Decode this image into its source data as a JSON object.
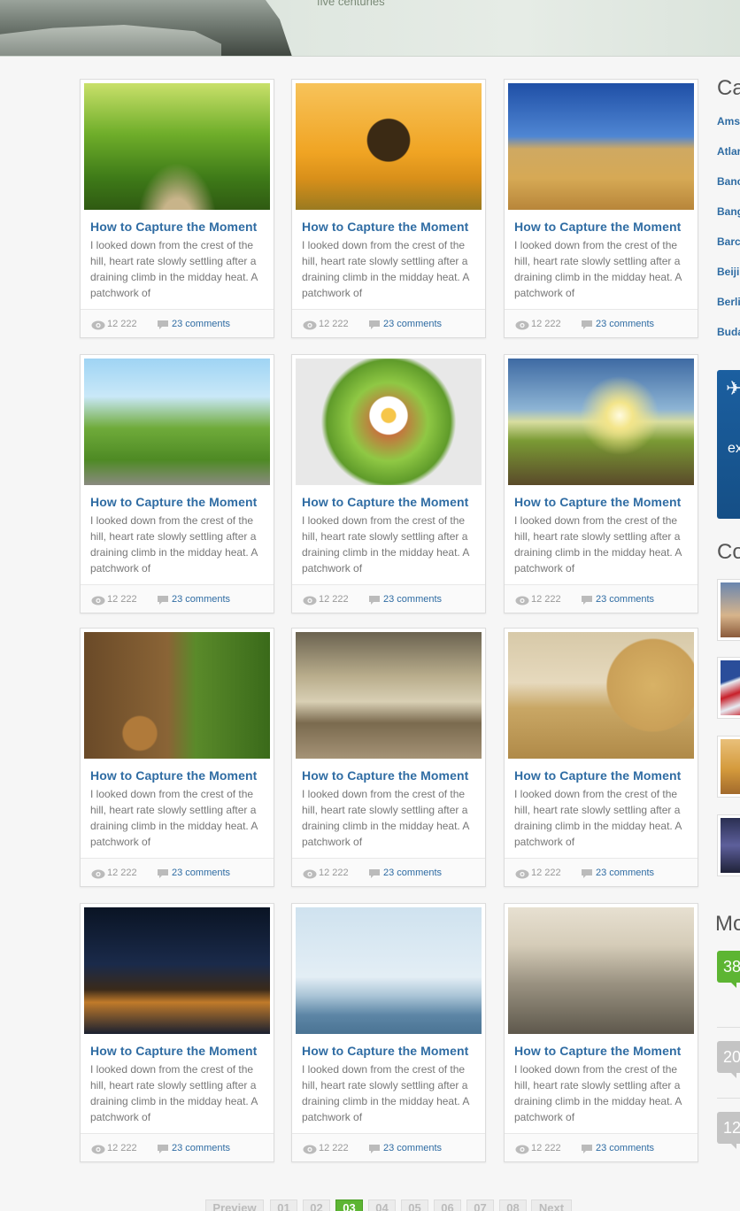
{
  "hero": {
    "tagline": "five centuries"
  },
  "posts": [
    {
      "title": "How to Capture the Moment",
      "excerpt": "I looked down from the crest of the hill, heart rate slowly settling after a draining climb in the midday heat. A patchwork of",
      "views": "12 222",
      "comments": "23 comments",
      "image": "forest-path"
    },
    {
      "title": "How to Capture the Moment",
      "excerpt": "I looked down from the crest of the hill, heart rate slowly settling after a draining climb in the midday heat. A patchwork of",
      "views": "12 222",
      "comments": "23 comments",
      "image": "orange-tree"
    },
    {
      "title": "How to Capture the Moment",
      "excerpt": "I looked down from the crest of the hill, heart rate slowly settling after a draining climb in the midday heat. A patchwork of",
      "views": "12 222",
      "comments": "23 comments",
      "image": "wheat-field"
    },
    {
      "title": "How to Capture the Moment",
      "excerpt": "I looked down from the crest of the hill, heart rate slowly settling after a draining climb in the midday heat. A patchwork of",
      "views": "12 222",
      "comments": "23 comments",
      "image": "fence-road"
    },
    {
      "title": "How to Capture the Moment",
      "excerpt": "I looked down from the crest of the hill, heart rate slowly settling after a draining climb in the midday heat. A patchwork of",
      "views": "12 222",
      "comments": "23 comments",
      "image": "salad"
    },
    {
      "title": "How to Capture the Moment",
      "excerpt": "I looked down from the crest of the hill, heart rate slowly settling after a draining climb in the midday heat. A patchwork of",
      "views": "12 222",
      "comments": "23 comments",
      "image": "sunrise-field"
    },
    {
      "title": "How to Capture the Moment",
      "excerpt": "I looked down from the crest of the hill, heart rate slowly settling after a draining climb in the midday heat. A patchwork of",
      "views": "12 222",
      "comments": "23 comments",
      "image": "wooden-cabin"
    },
    {
      "title": "How to Capture the Moment",
      "excerpt": "I looked down from the crest of the hill, heart rate slowly settling after a draining climb in the midday heat. A patchwork of",
      "views": "12 222",
      "comments": "23 comments",
      "image": "cloudy-sky"
    },
    {
      "title": "How to Capture the Moment",
      "excerpt": "I looked down from the crest of the hill, heart rate slowly settling after a draining climb in the midday heat. A patchwork of",
      "views": "12 222",
      "comments": "23 comments",
      "image": "hay-bale"
    },
    {
      "title": "How to Capture the Moment",
      "excerpt": "I looked down from the crest of the hill, heart rate slowly settling after a draining climb in the midday heat. A patchwork of",
      "views": "12 222",
      "comments": "23 comments",
      "image": "night-bridge"
    },
    {
      "title": "How to Capture the Moment",
      "excerpt": "I looked down from the crest of the hill, heart rate slowly settling after a draining climb in the midday heat. A patchwork of",
      "views": "12 222",
      "comments": "23 comments",
      "image": "day-bridge"
    },
    {
      "title": "How to Capture the Moment",
      "excerpt": "I looked down from the crest of the hill, heart rate slowly settling after a draining climb in the midday heat. A patchwork of",
      "views": "12 222",
      "comments": "23 comments",
      "image": "skyline"
    }
  ],
  "sidebar": {
    "categories_heading": "Ca",
    "categories": [
      "Ams",
      "Atlar",
      "Banc",
      "Bang",
      "Barc",
      "Beiji",
      "Berli",
      "Buda"
    ],
    "ad_text": "ex",
    "second_heading": "Co",
    "third_heading": "Mo",
    "badges": [
      "38",
      "20",
      "12"
    ]
  },
  "pagination": [
    "Preview",
    "01",
    "02",
    "03",
    "04",
    "05",
    "06",
    "07",
    "08",
    "Next"
  ],
  "pagination_active": "03",
  "colors": {
    "link": "#2f6ca3",
    "accent_green": "#5db533",
    "badge_grey": "#c4c4c4"
  }
}
